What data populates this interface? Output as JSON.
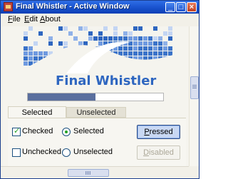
{
  "window": {
    "title": "Final Whistler - Active Window",
    "controls": {
      "minimize": "_",
      "maximize": "□",
      "close": "×"
    }
  },
  "menu": {
    "items": [
      {
        "mnemonic": "F",
        "rest": "ile"
      },
      {
        "mnemonic": "E",
        "rest": "dit"
      },
      {
        "mnemonic": "A",
        "rest": "bout"
      }
    ]
  },
  "banner": {
    "title": "Final Whistler",
    "color": "#2e66c0"
  },
  "progress": {
    "value_fraction": 0.5,
    "fill_color": "#5a6f9e"
  },
  "tabs": [
    {
      "label": "Selected",
      "active": true
    },
    {
      "label": "Unselected",
      "active": false
    }
  ],
  "controls": {
    "checked_checkbox": {
      "label": "Checked",
      "checked": true
    },
    "unchecked_checkbox": {
      "label": "Unchecked",
      "checked": false
    },
    "selected_radio": {
      "label": "Selected",
      "selected": true
    },
    "unselected_radio": {
      "label": "Unselected",
      "selected": false
    }
  },
  "buttons": {
    "pressed": {
      "mnemonic": "P",
      "rest": "ressed"
    },
    "disabled": {
      "mnemonic": "D",
      "rest": "isabled"
    }
  },
  "icons": {
    "window_icon": "app-icon",
    "check": "✓"
  }
}
